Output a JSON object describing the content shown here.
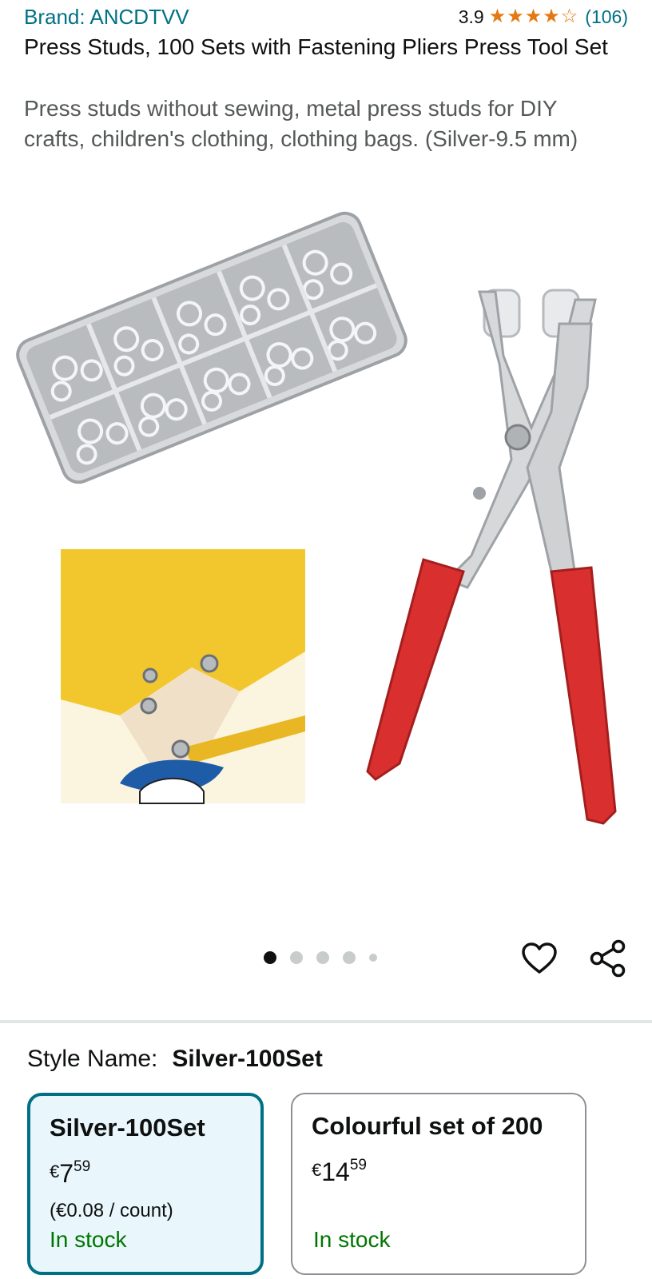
{
  "header": {
    "brand": "Brand: ANCDTVV",
    "rating_value": "3.9",
    "rating_stars": 3.9,
    "rating_count": "(106)"
  },
  "product": {
    "title": "Press Studs, 100 Sets with Fastening Pliers Press Tool Set",
    "subtitle": "Press studs without sewing, metal press studs for DIY crafts, children's clothing, clothing bags. (Silver-9.5 mm)"
  },
  "gallery": {
    "image_count": 5,
    "active_index": 0
  },
  "style": {
    "label": "Style Name:",
    "selected_value": "Silver-100Set",
    "options": [
      {
        "name": "Silver-100Set",
        "currency": "€",
        "price_whole": "7",
        "price_fraction": "59",
        "unit_price": "(€0.08 / count)",
        "stock": "In stock",
        "selected": true
      },
      {
        "name": "Colourful set of 200",
        "currency": "€",
        "price_whole": "14",
        "price_fraction": "59",
        "unit_price": "",
        "stock": "In stock",
        "selected": false
      }
    ]
  },
  "colors": {
    "link": "#007185",
    "stock_green": "#007600",
    "star": "#e47911",
    "selected_border": "#007185",
    "selected_bg": "#e9f6fb"
  }
}
